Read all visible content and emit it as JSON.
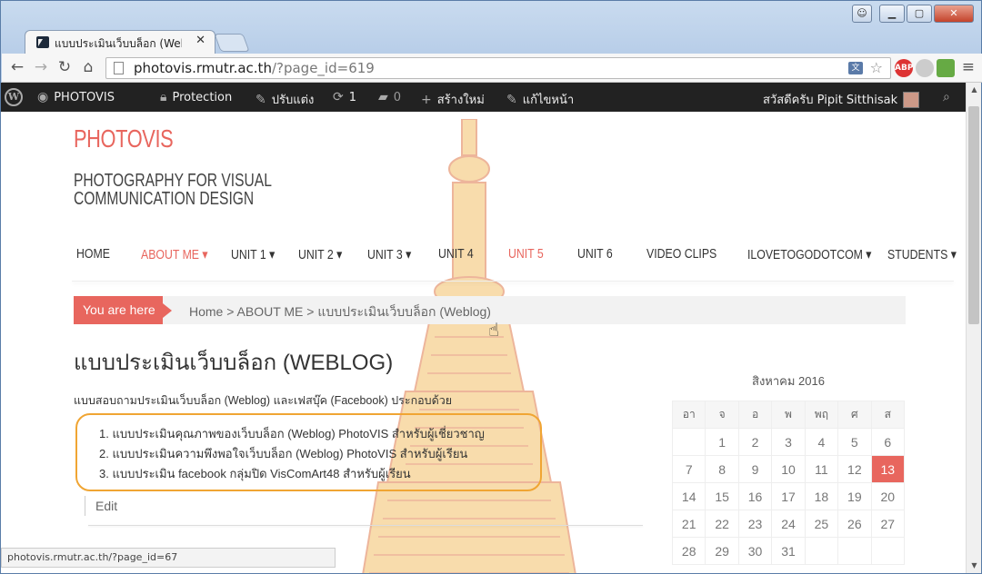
{
  "browser": {
    "tab_title": "แบบประเมินเว็บบล็อก (Webl",
    "url_host": "photovis.rmutr.ac.th",
    "url_path": "/?page_id=619",
    "abp_label": "ABP",
    "status_url": "photovis.rmutr.ac.th/?page_id=67"
  },
  "adminbar": {
    "site": "PHOTOVIS",
    "protection": "Protection",
    "customize": "ปรับแต่ง",
    "updates": "1",
    "comments": "0",
    "new": "สร้างใหม่",
    "edit": "แก้ไขหน้า",
    "greeting": "สวัสดีครับ Pipit Sitthisak"
  },
  "site": {
    "title": "PHOTOVIS",
    "description": "PHOTOGRAPHY FOR VISUAL COMMUNICATION DESIGN"
  },
  "nav": [
    {
      "label": "HOME"
    },
    {
      "label": "ABOUT ME ▾"
    },
    {
      "label": "UNIT 1 ▾"
    },
    {
      "label": "UNIT 2 ▾"
    },
    {
      "label": "UNIT 3 ▾"
    },
    {
      "label": "UNIT 4"
    },
    {
      "label": "UNIT 5"
    },
    {
      "label": "UNIT 6"
    },
    {
      "label": "VIDEO CLIPS"
    },
    {
      "label": "ILOVETOGODOTCOM ▾"
    },
    {
      "label": "STUDENTS ▾"
    }
  ],
  "breadcrumb": {
    "label": "You are here",
    "path": "Home > ABOUT ME > แบบประเมินเว็บบล็อก (Weblog)"
  },
  "page": {
    "title": "แบบประเมินเว็บบล็อก (WEBLOG)",
    "intro": "แบบสอบถามประเมินเว็บบล็อก (Weblog) และเฟสบุ๊ค (Facebook) ประกอบด้วย",
    "items": [
      "1. แบบประเมินคุณภาพของเว็บบล็อก (Weblog) PhotoVIS สำหรับผู้เชี่ยวชาญ",
      "2. แบบประเมินความพึงพอใจเว็บบล็อก (Weblog) PhotoVIS สำหรับผู้เรียน",
      "3. แบบประเมิน facebook กลุ่มปิด VisComArt48 สำหรับผู้เรียน"
    ],
    "edit": "Edit"
  },
  "calendar": {
    "caption": "สิงหาคม 2016",
    "days": [
      "อา",
      "จ",
      "อ",
      "พ",
      "พฤ",
      "ศ",
      "ส"
    ],
    "weeks": [
      [
        "",
        "1",
        "2",
        "3",
        "4",
        "5",
        "6"
      ],
      [
        "7",
        "8",
        "9",
        "10",
        "11",
        "12",
        "13"
      ],
      [
        "14",
        "15",
        "16",
        "17",
        "18",
        "19",
        "20"
      ],
      [
        "21",
        "22",
        "23",
        "24",
        "25",
        "26",
        "27"
      ],
      [
        "28",
        "29",
        "30",
        "31",
        "",
        "",
        ""
      ]
    ],
    "today": "13"
  }
}
